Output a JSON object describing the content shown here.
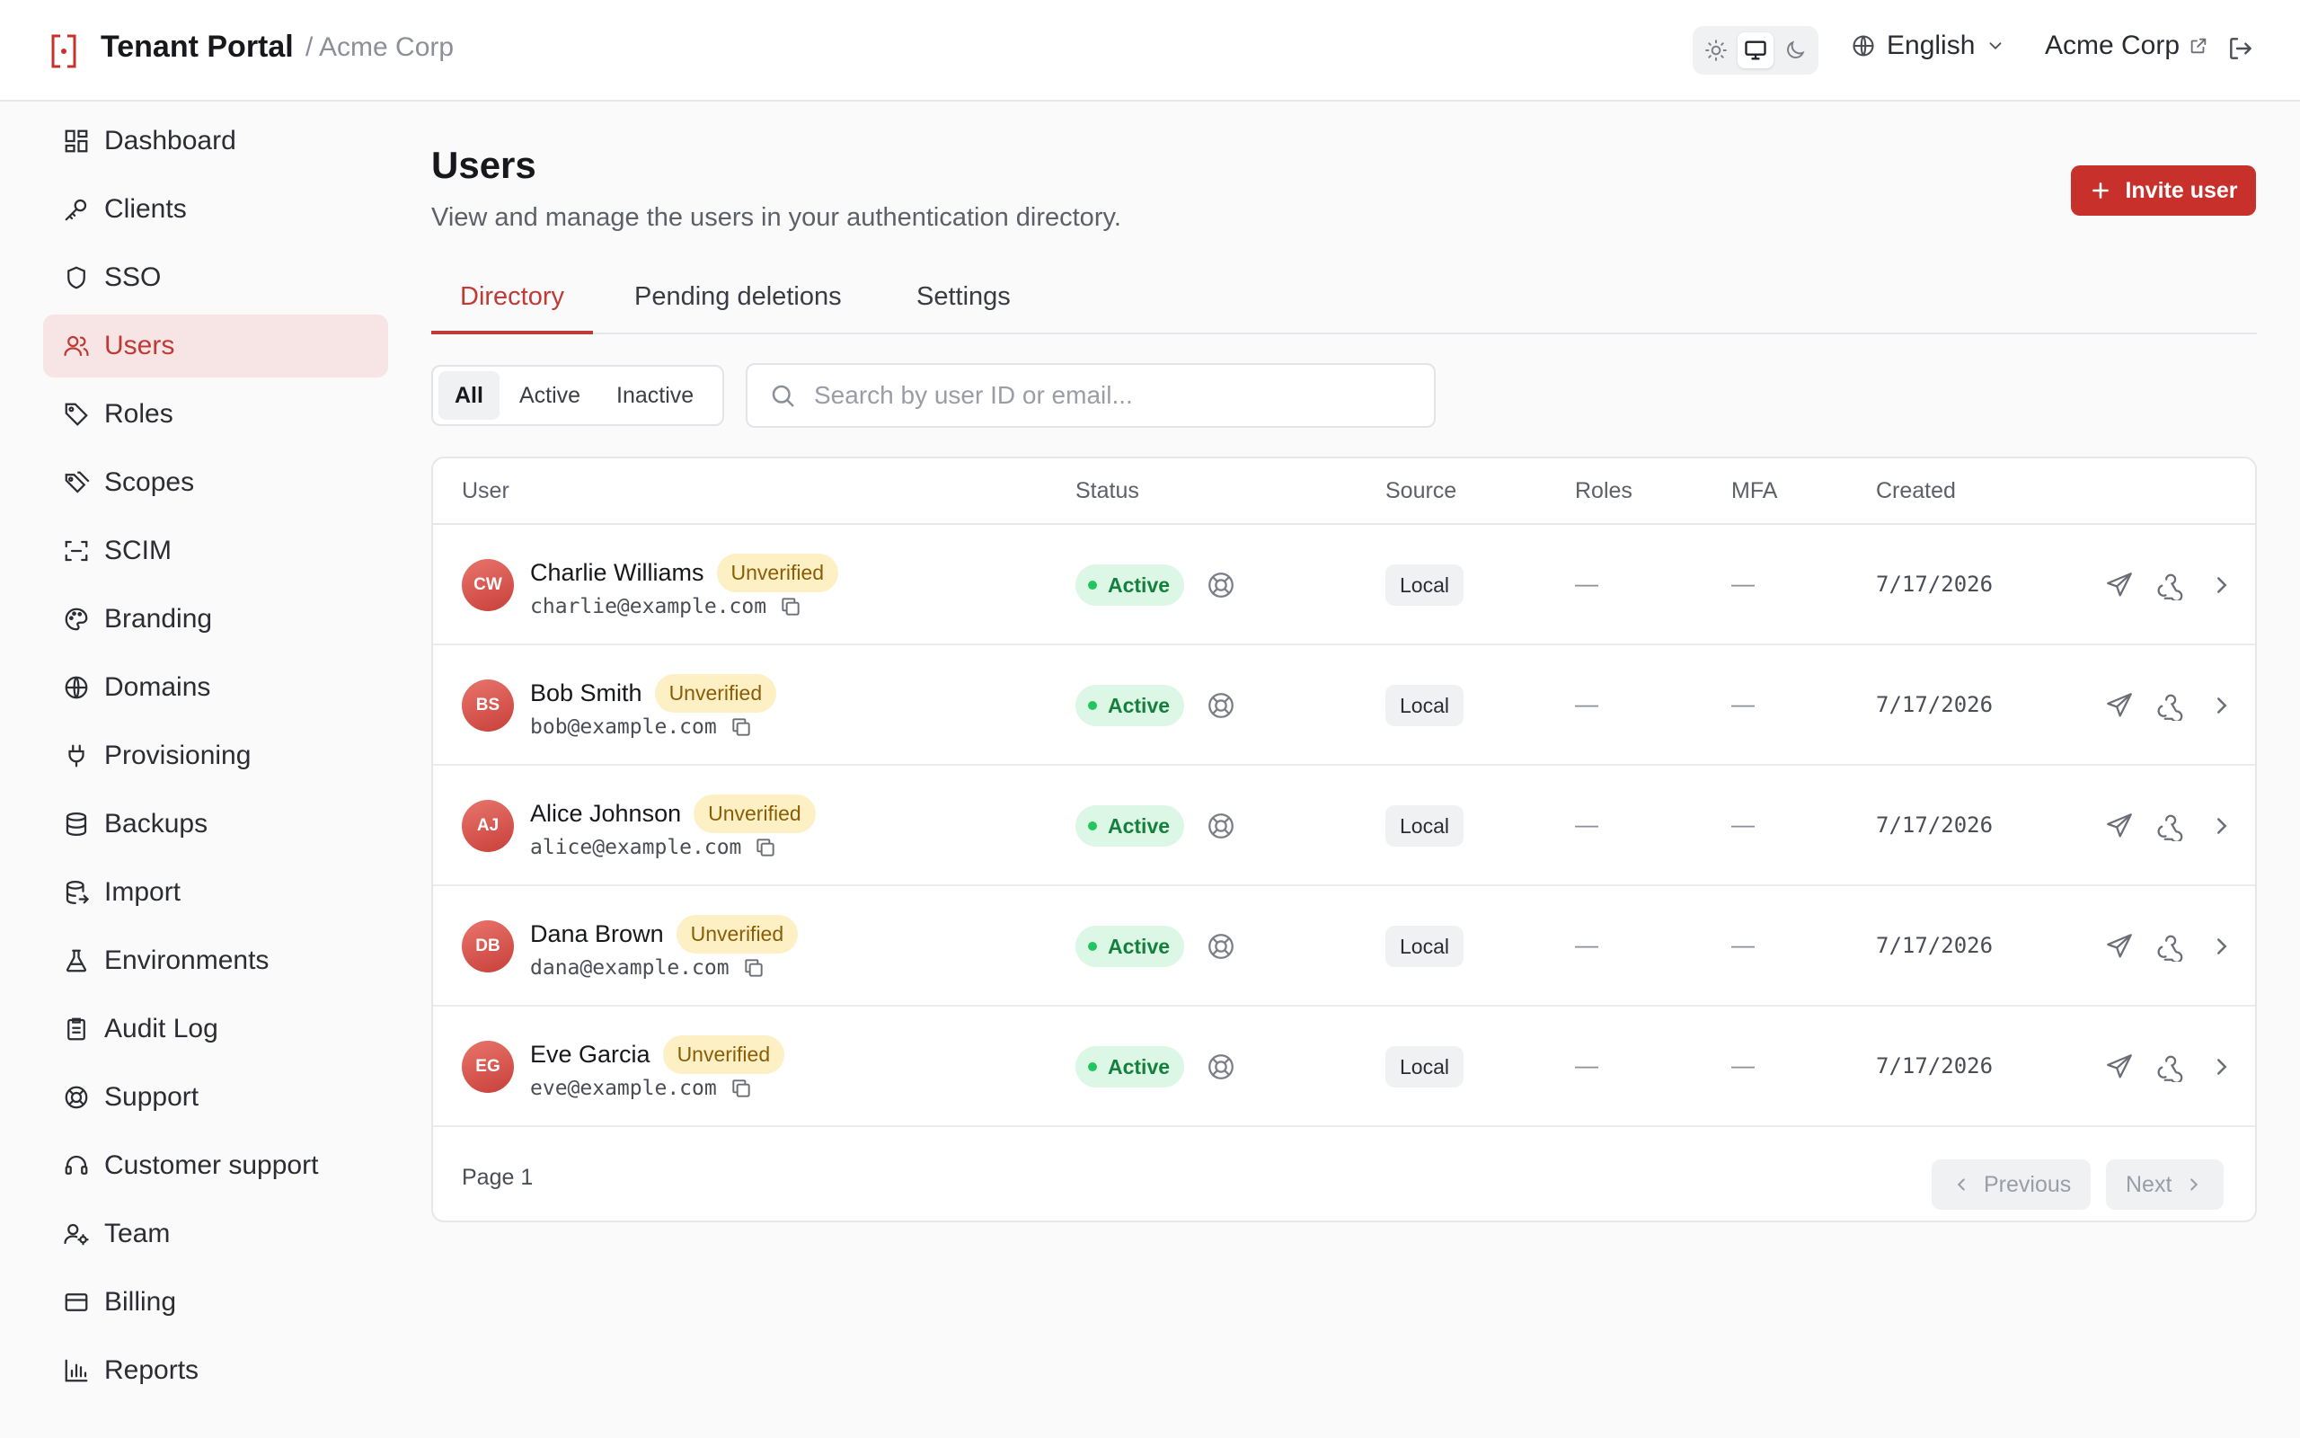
{
  "header": {
    "app_title": "Tenant Portal",
    "breadcrumb": "/ Acme Corp",
    "theme_modes": [
      "light",
      "system",
      "dark"
    ],
    "theme_selected": "system",
    "language": "English",
    "org_link": "Acme Corp"
  },
  "sidebar": {
    "items": [
      {
        "label": "Dashboard",
        "icon": "dashboard-icon"
      },
      {
        "label": "Clients",
        "icon": "key-icon"
      },
      {
        "label": "SSO",
        "icon": "shield-icon"
      },
      {
        "label": "Users",
        "icon": "users-icon",
        "active": true
      },
      {
        "label": "Roles",
        "icon": "tag-icon"
      },
      {
        "label": "Scopes",
        "icon": "tags-icon"
      },
      {
        "label": "SCIM",
        "icon": "scan-icon"
      },
      {
        "label": "Branding",
        "icon": "palette-icon"
      },
      {
        "label": "Domains",
        "icon": "globe-icon"
      },
      {
        "label": "Provisioning",
        "icon": "plug-icon"
      },
      {
        "label": "Backups",
        "icon": "database-icon"
      },
      {
        "label": "Import",
        "icon": "database-import-icon"
      },
      {
        "label": "Environments",
        "icon": "flask-icon"
      },
      {
        "label": "Audit Log",
        "icon": "clipboard-icon"
      },
      {
        "label": "Support",
        "icon": "lifebuoy-icon"
      },
      {
        "label": "Customer support",
        "icon": "headset-icon"
      },
      {
        "label": "Team",
        "icon": "user-cog-icon"
      },
      {
        "label": "Billing",
        "icon": "credit-card-icon"
      },
      {
        "label": "Reports",
        "icon": "bar-chart-icon"
      }
    ]
  },
  "main": {
    "title": "Users",
    "subtitle": "View and manage the users in your authentication directory.",
    "invite_label": "Invite user",
    "tabs": [
      {
        "label": "Directory",
        "active": true
      },
      {
        "label": "Pending deletions"
      },
      {
        "label": "Settings"
      }
    ],
    "filters": [
      {
        "label": "All",
        "active": true
      },
      {
        "label": "Active"
      },
      {
        "label": "Inactive"
      }
    ],
    "search_placeholder": "Search by user ID or email..."
  },
  "table": {
    "columns": [
      "User",
      "Status",
      "Source",
      "Roles",
      "MFA",
      "Created"
    ],
    "rows": [
      {
        "initials": "CW",
        "name": "Charlie Williams",
        "verification": "Unverified",
        "email": "charlie@example.com",
        "status": "Active",
        "source": "Local",
        "roles": "—",
        "mfa": "—",
        "created": "7/17/2026"
      },
      {
        "initials": "BS",
        "name": "Bob Smith",
        "verification": "Unverified",
        "email": "bob@example.com",
        "status": "Active",
        "source": "Local",
        "roles": "—",
        "mfa": "—",
        "created": "7/17/2026"
      },
      {
        "initials": "AJ",
        "name": "Alice Johnson",
        "verification": "Unverified",
        "email": "alice@example.com",
        "status": "Active",
        "source": "Local",
        "roles": "—",
        "mfa": "—",
        "created": "7/17/2026"
      },
      {
        "initials": "DB",
        "name": "Dana Brown",
        "verification": "Unverified",
        "email": "dana@example.com",
        "status": "Active",
        "source": "Local",
        "roles": "—",
        "mfa": "—",
        "created": "7/17/2026"
      },
      {
        "initials": "EG",
        "name": "Eve Garcia",
        "verification": "Unverified",
        "email": "eve@example.com",
        "status": "Active",
        "source": "Local",
        "roles": "—",
        "mfa": "—",
        "created": "7/17/2026"
      }
    ],
    "footer": {
      "page_label": "Page 1",
      "previous_label": "Previous",
      "next_label": "Next"
    }
  },
  "colors": {
    "accent": "#c8302c",
    "active_nav_bg": "#f7e4e5",
    "status_active_bg": "#dcf7e5",
    "status_active_fg": "#15803d",
    "unverified_bg": "#fdf0c4",
    "unverified_fg": "#8a5d06"
  }
}
